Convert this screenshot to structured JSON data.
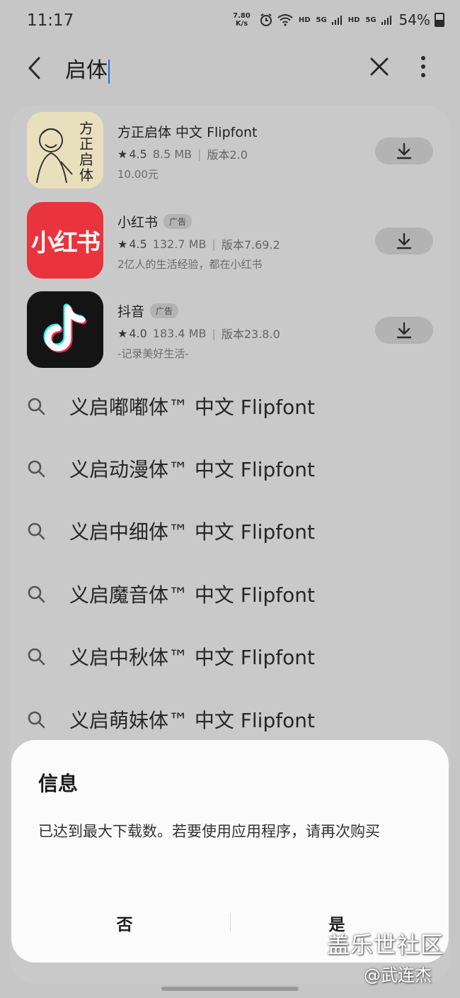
{
  "status_bar": {
    "time": "11:17",
    "speed_value": "7.80",
    "speed_unit": "K/s",
    "wifi_label": "HD",
    "net1": "5G",
    "net1_label": "HD",
    "net2": "5G",
    "battery": "54%"
  },
  "search": {
    "query": "启体"
  },
  "apps": [
    {
      "name": "方正启体 中文 Flipfont",
      "ad": "",
      "rating": "4.5",
      "size": "8.5 MB",
      "version": "版本2.0",
      "desc": "10.00元",
      "icon_text": "方正启体"
    },
    {
      "name": "小红书",
      "ad": "广告",
      "rating": "4.5",
      "size": "132.7 MB",
      "version": "版本7.69.2",
      "desc": "2亿人的生活经验，都在小红书",
      "icon_text": "小红书"
    },
    {
      "name": "抖音",
      "ad": "广告",
      "rating": "4.0",
      "size": "183.4 MB",
      "version": "版本23.8.0",
      "desc": "-记录美好生活-",
      "icon_text": ""
    }
  ],
  "suggestions": [
    "义启嘟嘟体™ 中文 Flipfont",
    "义启动漫体™ 中文 Flipfont",
    "义启中细体™ 中文 Flipfont",
    "义启魔音体™ 中文 Flipfont",
    "义启中秋体™ 中文 Flipfont",
    "义启萌妹体™ 中文 Flipfont"
  ],
  "dialog": {
    "title": "信息",
    "message": "已达到最大下载数。若要使用应用程序，请再次购买",
    "no_label": "否",
    "yes_label": "是"
  },
  "watermark": {
    "line1": "盖乐世社区",
    "line2": "@武连杰"
  },
  "icons": {
    "back": "chevron-left-icon",
    "clear": "close-icon",
    "more": "more-vertical-icon",
    "download": "download-icon",
    "search": "search-icon"
  },
  "colors": {
    "caret": "#1a73e8",
    "xhs_red": "#e9333d",
    "dialog_bg": "#fbfbfb"
  }
}
